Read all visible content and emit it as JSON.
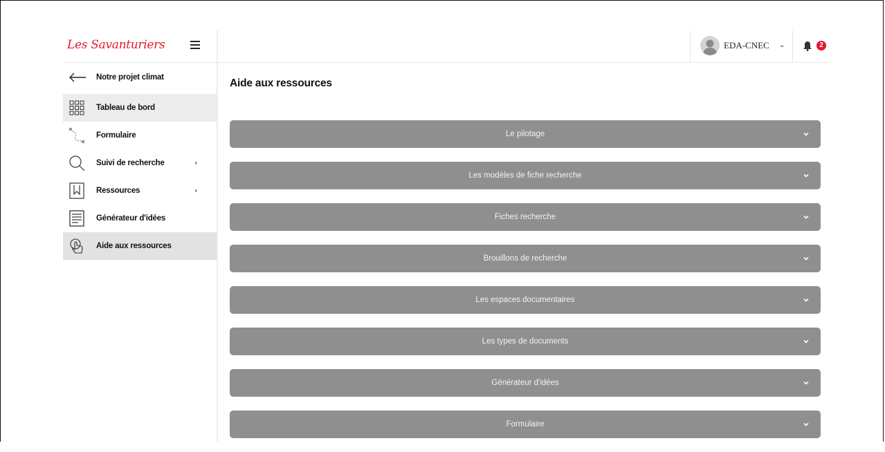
{
  "brand": {
    "logo_text": "Les Savanturiers",
    "accent_color": "#e2192b"
  },
  "sidebar": {
    "back_label": "Notre projet climat",
    "items": [
      {
        "label": "Tableau de bord",
        "icon": "grid-icon",
        "has_submenu": false
      },
      {
        "label": "Formulaire",
        "icon": "dotted-path-icon",
        "has_submenu": false
      },
      {
        "label": "Suivi de recherche",
        "icon": "search-icon",
        "has_submenu": true
      },
      {
        "label": "Ressources",
        "icon": "bookmark-icon",
        "has_submenu": true
      },
      {
        "label": "Générateur d'idées",
        "icon": "document-icon",
        "has_submenu": false
      },
      {
        "label": "Aide aux ressources",
        "icon": "hand-touch-icon",
        "has_submenu": false,
        "active": true
      }
    ],
    "submenu_chevron": "›"
  },
  "topbar": {
    "user_name": "EDA-CNEC",
    "user_chevron": "⌄",
    "notification_count": "2"
  },
  "main": {
    "title": "Aide aux ressources",
    "sections": [
      "Le pilotage",
      "Les modèles de fiche recherche",
      "Fiches recherche",
      "Brouillons de recherche",
      "Les espaces documentaires",
      "Les types de documents",
      "Générateur d'idées",
      "Formulaire"
    ]
  }
}
